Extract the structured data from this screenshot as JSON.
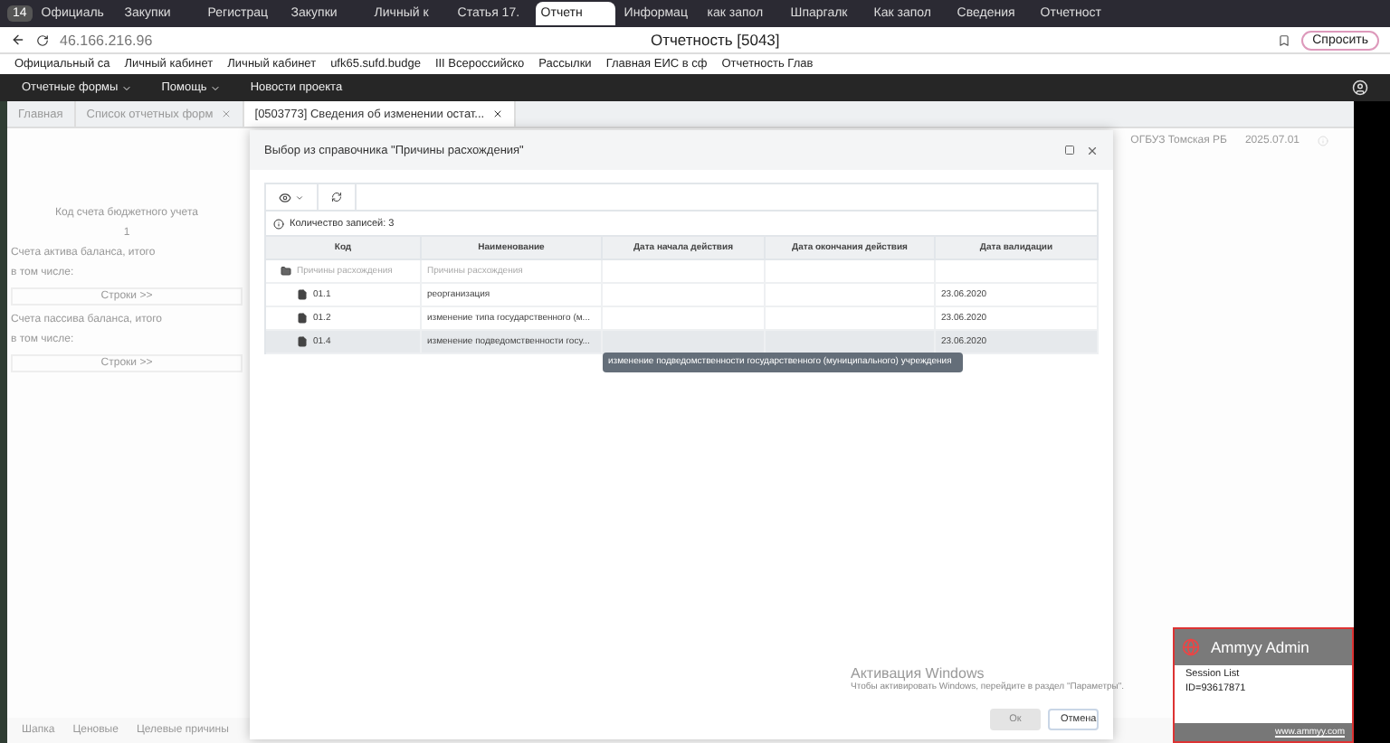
{
  "browser": {
    "tab_count": "14",
    "tabs": [
      {
        "label": "Официаль",
        "selected": false
      },
      {
        "label": "Закупки",
        "selected": false
      },
      {
        "label": "Регистрац",
        "selected": false
      },
      {
        "label": "Закупки",
        "selected": false
      },
      {
        "label": "Личный к",
        "selected": false
      },
      {
        "label": "Статья 17.",
        "selected": false
      },
      {
        "label": "Отчетн",
        "selected": true
      },
      {
        "label": "Информац",
        "selected": false
      },
      {
        "label": "как запол",
        "selected": false
      },
      {
        "label": "Шпаргалк",
        "selected": false
      },
      {
        "label": "Как запол",
        "selected": false
      },
      {
        "label": "Сведения",
        "selected": false
      },
      {
        "label": "Отчетност",
        "selected": false
      }
    ],
    "address": "46.166.216.96",
    "page_title": "Отчетность [5043]",
    "ask_button": "Спросить",
    "bookmarks": [
      "Официальный са",
      "Личный кабинет",
      "Личный кабинет",
      "ufk65.sufd.budge",
      "III Всероссийско",
      "Рассылки",
      "Главная ЕИС в сф",
      "Отчетность Глав"
    ]
  },
  "app": {
    "menu": [
      "Отчетные формы",
      "Помощь",
      "Новости проекта"
    ],
    "tabs": [
      {
        "label": "Главная",
        "selected": false,
        "closable": false
      },
      {
        "label": "Список отчетных форм",
        "selected": false,
        "closable": true
      },
      {
        "label": "[0503773] Сведения об изменении остат...",
        "selected": true,
        "closable": true
      }
    ],
    "organization": "ОГБУЗ Томская РБ",
    "period": "2025.07.01",
    "background": {
      "header": "Код счета бюджетного учета",
      "column_number": "1",
      "lines": [
        {
          "kind": "text",
          "text": "Счета актива баланса, итого"
        },
        {
          "kind": "text",
          "text": "в том числе:"
        },
        {
          "kind": "rows",
          "text": "Строки >>"
        },
        {
          "kind": "text",
          "text": "Счета пассива баланса, итого"
        },
        {
          "kind": "text",
          "text": "в том числе:"
        },
        {
          "kind": "rows",
          "text": "Строки >>"
        }
      ],
      "bottom_tabs": [
        "Шапка",
        "Ценовые",
        "Целевые причины"
      ]
    }
  },
  "dialog": {
    "title": "Выбор из справочника \"Причины расхождения\"",
    "record_count": "Количество записей: 3",
    "table": {
      "columns": [
        "Код",
        "Наименование",
        "Дата начала действия",
        "Дата окончания действия",
        "Дата валидации"
      ],
      "rows": [
        {
          "kind": "folder",
          "code": "Причины расхождения",
          "name": "Причины расхождения",
          "selected": false,
          "children": [
            {
              "kind": "item",
              "code": "01.1",
              "name": "реорганизация",
              "validation_date": "23.06.2020",
              "selected": false
            },
            {
              "kind": "item",
              "code": "01.2",
              "name": "изменение типа государственного (м...",
              "validation_date": "23.06.2020",
              "selected": false
            },
            {
              "kind": "item",
              "code": "01.4",
              "name": "изменение подведомственности госу...",
              "validation_date": "23.06.2020",
              "selected": true
            }
          ]
        }
      ]
    },
    "tooltip": "изменение подведомственности государственного (муниципального) учреждения",
    "buttons": [
      {
        "label": "Ок",
        "disabled": true
      },
      {
        "label": "Отмена",
        "disabled": false
      }
    ]
  },
  "remote_widget": {
    "title": "Ammyy Admin",
    "session_list": "Session List",
    "id": "ID=93617871",
    "link": "www.ammyy.com"
  },
  "activation": {
    "title": "Активация Windows",
    "text": "Чтобы активировать Windows, перейдите в раздел \"Параметры\"."
  }
}
